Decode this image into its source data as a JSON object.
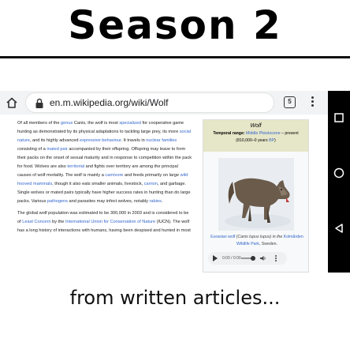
{
  "title": "Season 2",
  "caption": "from written articles...",
  "browser": {
    "url": "en.m.wikipedia.org/wiki/Wolf",
    "tab_count": "5"
  },
  "article": {
    "p1": [
      {
        "t": "Of all members of the "
      },
      {
        "t": "genus",
        "link": true
      },
      {
        "t": " Canis, the wolf is most "
      },
      {
        "t": "specialized",
        "link": true
      },
      {
        "t": " for cooperative game hunting as demonstrated by its physical adaptations to tackling large prey, its more "
      },
      {
        "t": "social nature",
        "link": true
      },
      {
        "t": ", and its highly advanced "
      },
      {
        "t": "expressive behaviour",
        "link": true
      },
      {
        "t": ". It travels in "
      },
      {
        "t": "nuclear families",
        "link": true
      },
      {
        "t": " consisting of a "
      },
      {
        "t": "mated pair",
        "link": true
      },
      {
        "t": " accompanied by their offspring. Offspring may leave to form their packs on the onset of sexual maturity and in response to competition within the pack for food. Wolves are also "
      },
      {
        "t": "territorial",
        "link": true
      },
      {
        "t": " and fights over territory are among the principal causes of wolf mortality. The wolf is mainly a "
      },
      {
        "t": "carnivore",
        "link": true
      },
      {
        "t": " and feeds primarily on large "
      },
      {
        "t": "wild hooved mammals",
        "link": true
      },
      {
        "t": ", though it also eats smaller animals, livestock, "
      },
      {
        "t": "carrion",
        "link": true
      },
      {
        "t": ", and garbage. Single wolves or mated pairs typically have higher success rates in hunting than do large packs. Various "
      },
      {
        "t": "pathogens",
        "link": true
      },
      {
        "t": " and parasites may infect wolves, notably "
      },
      {
        "t": "rabies",
        "link": true
      },
      {
        "t": "."
      }
    ],
    "p2": [
      {
        "t": "The global wolf population was estimated to be 300,000 in 2003 and is considered to be of "
      },
      {
        "t": "Least Concern",
        "link": true
      },
      {
        "t": " by the "
      },
      {
        "t": "International Union for Conservation of Nature",
        "link": true
      },
      {
        "t": " (IUCN). The wolf has a long history of interactions with humans, having been despised and hunted in most"
      }
    ]
  },
  "infobox": {
    "title": "Wolf",
    "range_label": "Temporal range: ",
    "range_link": "Middle Pleistocene",
    "range_suffix": " – present",
    "range_line2": "(810,000–0 years ",
    "range_bp": "BP",
    "range_end": ")",
    "caption_link1": "Eurasian wolf",
    "caption_mid": " (Canis lupus lupus) in the ",
    "caption_link2": "Kolmården Wildlife Park",
    "caption_end": ", Sweden.",
    "audio_time": "0:00 / 0:00"
  },
  "colors": {
    "link": "#3366cc",
    "infobox_header": "#e6e6c8",
    "nav_bar": "#000000"
  }
}
